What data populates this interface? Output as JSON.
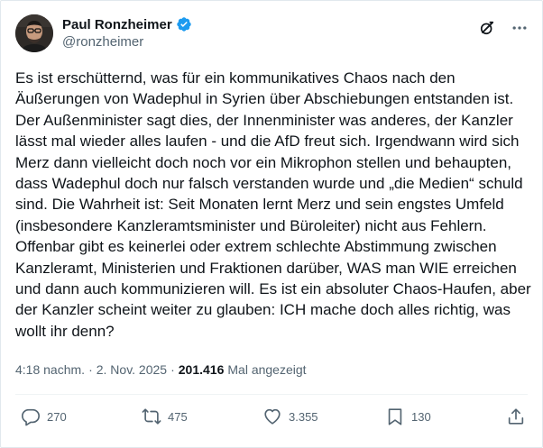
{
  "author": {
    "display_name": "Paul Ronzheimer",
    "handle": "@ronzheimer",
    "verified": true,
    "verified_color": "#1d9bf0"
  },
  "header": {
    "grok_icon": "grok-icon",
    "more_icon": "more-horizontal-icon"
  },
  "tweet": {
    "text": "Es ist erschütternd, was für ein kommunikatives Chaos nach den Äußerungen von Wadephul in Syrien über Abschiebungen entstanden ist. Der Außenminister sagt dies, der Innenminister was anderes, der Kanzler lässt mal wieder alles laufen - und die AfD freut sich. Irgendwann wird sich Merz dann vielleicht doch noch vor ein Mikrophon stellen und behaupten, dass Wadephul doch nur falsch verstanden wurde und „die Medien“ schuld sind. Die Wahrheit ist: Seit Monaten lernt Merz und sein engstes Umfeld (insbesondere Kanzleramtsminister und Büroleiter) nicht aus Fehlern. Offenbar gibt es keinerlei oder extrem schlechte Abstimmung zwischen Kanzleramt, Ministerien und Fraktionen darüber, WAS man WIE erreichen und dann auch kommunizieren will. Es ist ein absoluter Chaos-Haufen, aber der Kanzler scheint weiter zu glauben: ICH mache doch alles richtig, was wollt ihr denn?"
  },
  "meta": {
    "time": "4:18 nachm.",
    "separator": "·",
    "date": "2. Nov. 2025",
    "views_count": "201.416",
    "views_label": "Mal angezeigt"
  },
  "actions": {
    "replies": "270",
    "reposts": "475",
    "likes": "3.355",
    "bookmarks": "130"
  },
  "colors": {
    "text_primary": "#0f1419",
    "text_secondary": "#536471",
    "border": "#eff3f4"
  }
}
